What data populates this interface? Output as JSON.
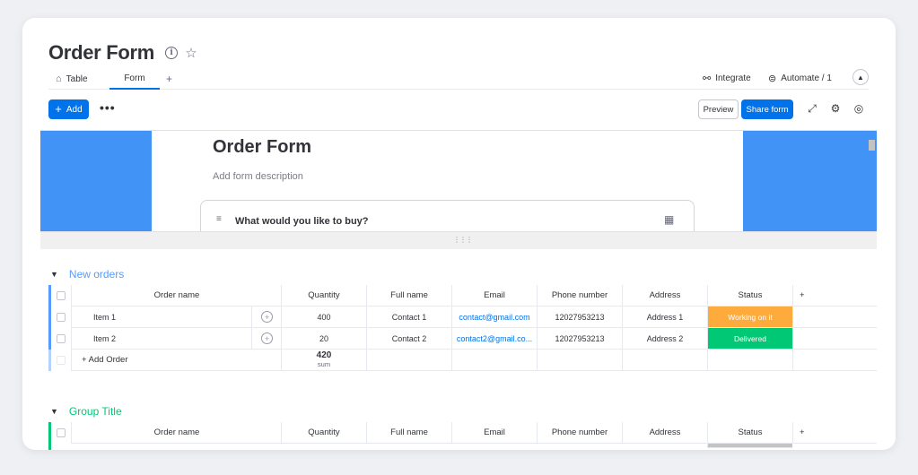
{
  "board": {
    "title": "Order Form"
  },
  "tabs": {
    "table": "Table",
    "form": "Form",
    "add": "+"
  },
  "topright": {
    "integrate": "Integrate",
    "automate": "Automate / 1"
  },
  "toolbar": {
    "add": "Add",
    "preview": "Preview",
    "share": "Share form"
  },
  "form": {
    "title": "Order Form",
    "description": "Add form description",
    "question": "What would you like to buy?"
  },
  "columns": [
    "Order name",
    "Quantity",
    "Full name",
    "Email",
    "Phone number",
    "Address",
    "Status"
  ],
  "groups": [
    {
      "title": "New orders",
      "color": "#579bfc",
      "rows": [
        {
          "name": "Item 1",
          "quantity": "400",
          "full_name": "Contact 1",
          "email": "contact@gmail.com",
          "phone": "12027953213",
          "address": "Address 1",
          "status": "Working on it",
          "status_color": "#fdab3d"
        },
        {
          "name": "Item 2",
          "quantity": "20",
          "full_name": "Contact 2",
          "email": "contact2@gmail.co...",
          "phone": "12027953213",
          "address": "Address 2",
          "status": "Delivered",
          "status_color": "#00c875"
        }
      ],
      "add_label": "+ Add Order",
      "sum_value": "420",
      "sum_label": "sum"
    },
    {
      "title": "Group Title",
      "color": "#00c875"
    }
  ],
  "icons": {
    "info": "info-icon",
    "star": "star-icon",
    "home": "home-icon",
    "integrate": "integrate-icon",
    "automate": "robot-icon",
    "collapse": "chevron-up-icon",
    "more": "more-dots-icon",
    "fullscreen": "fullscreen-icon",
    "settings": "gear-icon",
    "feedback": "chat-icon",
    "question": "text-lines-icon",
    "table": "table-icon",
    "conversation": "add-update-icon",
    "chevron": "chevron-down-icon"
  }
}
